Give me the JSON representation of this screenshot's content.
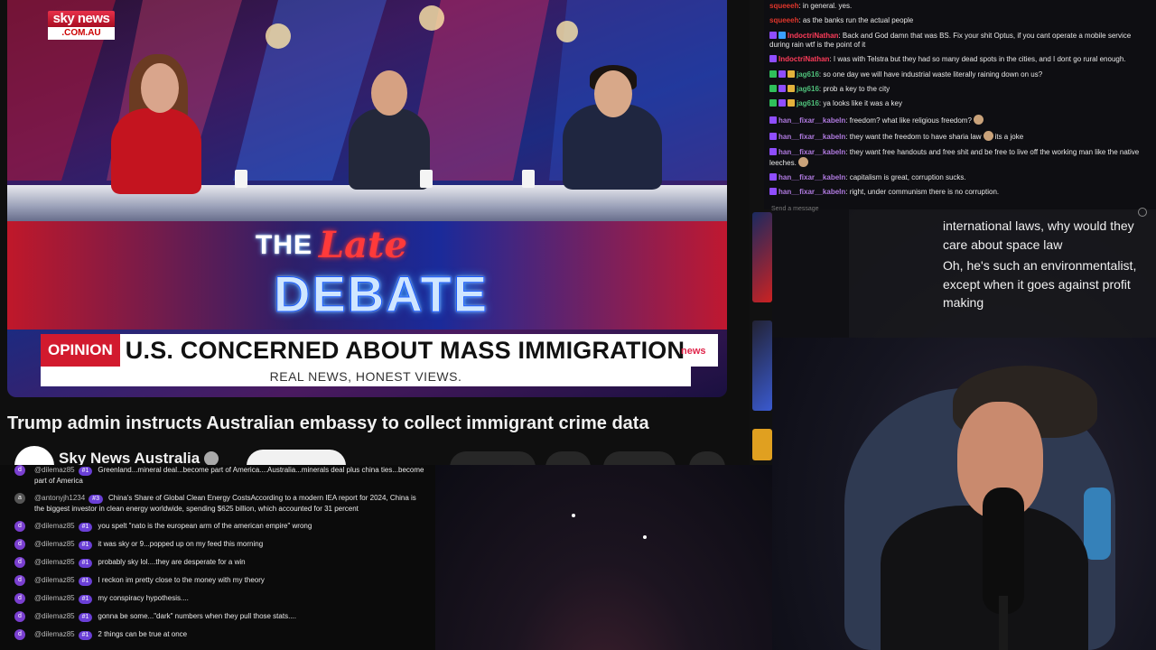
{
  "video": {
    "logo_top": "sky news",
    "logo_bottom": ".COM.AU",
    "show_title_the": "THE",
    "show_title_late": "Late",
    "show_title_debate": "DEBATE",
    "opinion_tag": "OPINION",
    "headline": "U.S. CONCERNED ABOUT MASS IMMIGRATION",
    "sky_bug": "news",
    "tagline": "REAL NEWS, HONEST VIEWS.",
    "title": "Trump admin instructs Australian embassy to collect immigrant crime data",
    "channel_name": "Sky News Australia"
  },
  "chat_top": {
    "messages": [
      {
        "user": "squeeeh",
        "user_color": "#e0352b",
        "text": "in general. yes.",
        "badges": []
      },
      {
        "user": "squeeeh",
        "user_color": "#e0352b",
        "text": "as the banks run the actual people",
        "badges": []
      },
      {
        "user": "IndoctriNathan",
        "user_color": "#ff3c5a",
        "text": "Back and God damn that was BS. Fix your shit Optus, if you cant operate a mobile service during rain wtf is the point of it",
        "badges": [
          "#8f4dff",
          "#3aa0ff"
        ]
      },
      {
        "user": "IndoctriNathan",
        "user_color": "#ff3c5a",
        "text": "I was with Telstra but they had so many dead spots in the cities, and I dont go rural enough.",
        "badges": [
          "#8f4dff"
        ]
      },
      {
        "user": "jag616",
        "user_color": "#4fbf7a",
        "text": "so one day we will have industrial waste literally raining down on us?",
        "badges": [
          "#2fbf5a",
          "#8f4dff",
          "#e3b23c"
        ]
      },
      {
        "user": "jag616",
        "user_color": "#4fbf7a",
        "text": "prob a key to the city",
        "badges": [
          "#2fbf5a",
          "#8f4dff",
          "#e3b23c"
        ]
      },
      {
        "user": "jag616",
        "user_color": "#4fbf7a",
        "text": "ya looks like it was a key",
        "badges": [
          "#2fbf5a",
          "#8f4dff",
          "#e3b23c"
        ]
      },
      {
        "user": "han__fixar__kabeln",
        "user_color": "#b07ae0",
        "text": "freedom? what like religious freedom?",
        "badges": [
          "#8f4dff"
        ],
        "emote": true
      },
      {
        "user": "han__fixar__kabeln",
        "user_color": "#b07ae0",
        "text": "they want the freedom to have sharia law",
        "badges": [
          "#8f4dff"
        ],
        "emote": true,
        "text2": "its a joke"
      },
      {
        "user": "han__fixar__kabeln",
        "user_color": "#b07ae0",
        "text": "they want free handouts and free shit and be free to live off the working man like the native leeches.",
        "badges": [
          "#8f4dff"
        ],
        "emote": true
      },
      {
        "user": "han__fixar__kabeln",
        "user_color": "#b07ae0",
        "text": "capitalism is great, corruption sucks.",
        "badges": [
          "#8f4dff"
        ]
      },
      {
        "user": "han__fixar__kabeln",
        "user_color": "#b07ae0",
        "text": "right, under communism there is no corruption.",
        "badges": [
          "#8f4dff"
        ]
      }
    ],
    "input_placeholder": "Send a message"
  },
  "captions": {
    "line1": "international laws, why would they care about space law",
    "line2": "Oh, he's such an environmentalist, except when it goes against profit making"
  },
  "chat_bottom": {
    "messages": [
      {
        "avatar": "d",
        "avatar_color": "#7a3fd0",
        "user": "@dilemaz85",
        "rank": "#1",
        "text": "Greenland...mineral deal...become part of America....Australia...minerals deal plus china ties...become part of America"
      },
      {
        "avatar": "a",
        "avatar_color": "#555",
        "user": "@antonyjh1234",
        "rank": "#3",
        "text": "China's Share of Global Clean Energy CostsAccording to a modern IEA report for 2024, China is the biggest investor in clean energy worldwide, spending $625 billion, which accounted for 31 percent"
      },
      {
        "avatar": "d",
        "avatar_color": "#7a3fd0",
        "user": "@dilemaz85",
        "rank": "#1",
        "text": "you spelt \"nato is the european arm of the american empire\" wrong"
      },
      {
        "avatar": "d",
        "avatar_color": "#7a3fd0",
        "user": "@dilemaz85",
        "rank": "#1",
        "text": "it was sky or 9...popped up on my feed this morning"
      },
      {
        "avatar": "d",
        "avatar_color": "#7a3fd0",
        "user": "@dilemaz85",
        "rank": "#1",
        "text": "probably sky lol....they are desperate for a win"
      },
      {
        "avatar": "d",
        "avatar_color": "#7a3fd0",
        "user": "@dilemaz85",
        "rank": "#1",
        "text": "I reckon im pretty close to the money with my theory"
      },
      {
        "avatar": "d",
        "avatar_color": "#7a3fd0",
        "user": "@dilemaz85",
        "rank": "#1",
        "text": "my conspiracy hypothesis...."
      },
      {
        "avatar": "d",
        "avatar_color": "#7a3fd0",
        "user": "@dilemaz85",
        "rank": "#1",
        "text": "gonna be some...\"dark\" numbers when they pull those stats...."
      },
      {
        "avatar": "d",
        "avatar_color": "#7a3fd0",
        "user": "@dilemaz85",
        "rank": "#1",
        "text": "2 things can be true at once"
      }
    ]
  },
  "colors": {
    "sky_red": "#d21a2e",
    "rank_purple": "#6a3fd6",
    "chat_bg": "#0e0e12"
  }
}
